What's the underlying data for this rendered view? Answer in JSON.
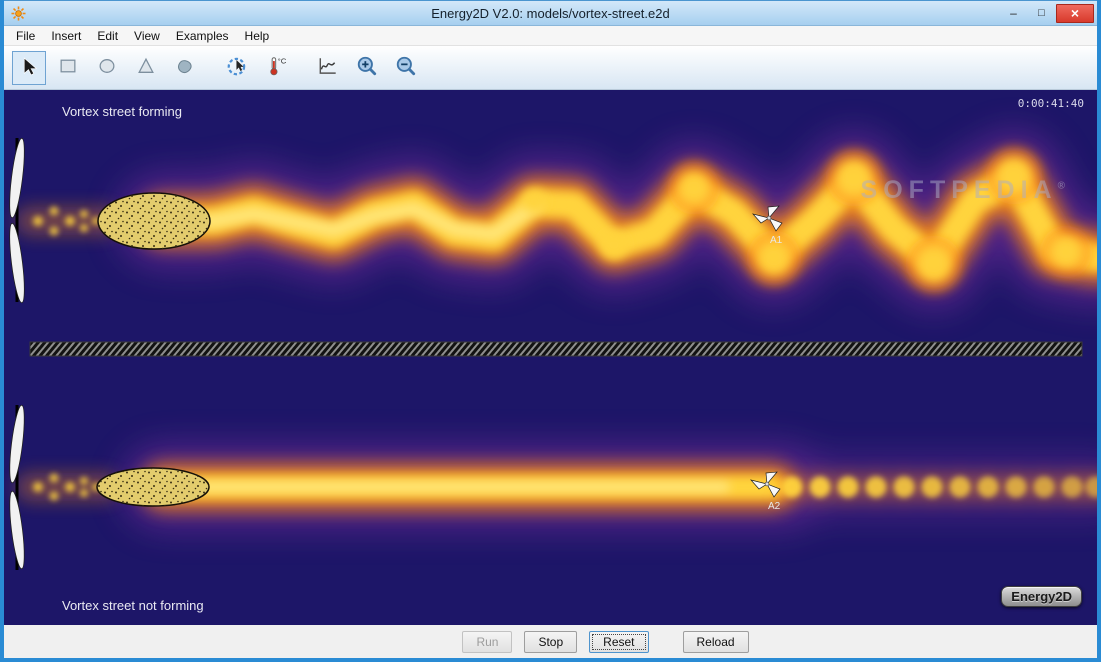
{
  "window": {
    "title": "Energy2D V2.0: models/vortex-street.e2d",
    "icons": {
      "app": "energy2d-sunburst",
      "minimize": "–",
      "maximize": "□",
      "close": "×"
    }
  },
  "menubar": {
    "items": [
      "File",
      "Insert",
      "Edit",
      "View",
      "Examples",
      "Help"
    ]
  },
  "toolbar": {
    "tools": [
      {
        "name": "select",
        "selected": true
      },
      {
        "name": "rectangle"
      },
      {
        "name": "ellipse"
      },
      {
        "name": "triangle"
      },
      {
        "name": "blob"
      },
      {
        "name": "interact"
      },
      {
        "name": "thermometer",
        "label": "°C"
      },
      {
        "name": "graph"
      },
      {
        "name": "zoom-in"
      },
      {
        "name": "zoom-out"
      }
    ]
  },
  "simulation": {
    "timer": "0:00:41:40",
    "captions": {
      "top": "Vortex street forming",
      "bottom": "Vortex street not forming"
    },
    "sensors": [
      {
        "id": "A1"
      },
      {
        "id": "A2"
      }
    ],
    "watermark": {
      "text": "SOFTPEDIA",
      "reg": "®"
    },
    "badge": "Energy2D"
  },
  "controls": {
    "buttons": [
      {
        "label": "Run",
        "enabled": false
      },
      {
        "label": "Stop",
        "enabled": true
      },
      {
        "label": "Reset",
        "enabled": true,
        "focused": true
      },
      {
        "label": "Reload",
        "enabled": true
      }
    ]
  },
  "colors": {
    "accent_blue": "#2a8bd4",
    "close_red": "#d83a2c",
    "canvas_bg": "#1d1668",
    "heat_core": "#ffd43c",
    "heat_mid": "#ff8d10",
    "heat_haze": "#7b2f9e",
    "obstacle_fill": "#e3cc6d"
  }
}
